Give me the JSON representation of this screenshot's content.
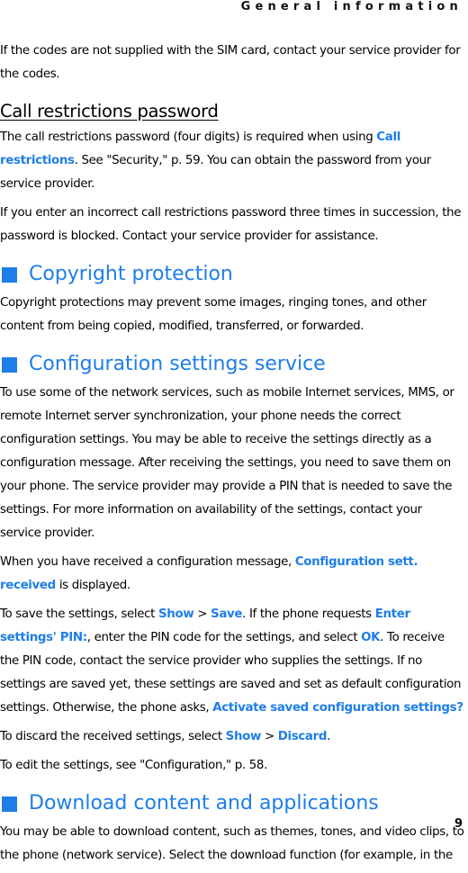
{
  "running_head": "General information",
  "page_number": "9",
  "accent_color": "#1e7ee8",
  "intro": {
    "text": "If the codes are not supplied with the SIM card, contact your service provider for the codes."
  },
  "call_restrictions": {
    "heading": "Call restrictions password",
    "p1": {
      "before": "The call restrictions password (four digits) is required when using ",
      "link": "Call restrictions",
      "after": ". See \"Security,\" p. 59. You can obtain the password from your service provider."
    },
    "p2": "If you enter an incorrect call restrictions password three times in succession, the password is blocked. Contact your service provider for assistance."
  },
  "copyright": {
    "heading": "Copyright protection",
    "p1": "Copyright protections may prevent some images, ringing tones, and other content from being copied, modified, transferred, or forwarded."
  },
  "configuration": {
    "heading": "Configuration settings service",
    "p1": "To use some of the network services, such as mobile Internet services, MMS, or remote Internet server synchronization, your phone needs the correct configuration settings. You may be able to receive the settings directly as a configuration message. After receiving the settings, you need to save them on your phone. The service provider may provide a PIN that is needed to save the settings. For more information on availability of the settings, contact your service provider.",
    "p2": {
      "before": "When you have received a configuration message, ",
      "link": "Configuration sett. received",
      "after": " is displayed."
    },
    "p3": {
      "t1": "To save the settings, select ",
      "l1": "Show",
      "t2": " > ",
      "l2": "Save",
      "t3": ". If the phone requests ",
      "l3": "Enter settings' PIN:",
      "t4": ", enter the PIN code for the settings, and select ",
      "l4": "OK",
      "t5": ". To receive the PIN code, contact the service provider who supplies the settings. If no settings are saved yet, these settings are saved and set as default configuration settings. Otherwise, the phone asks, ",
      "l5": "Activate saved configuration settings?"
    },
    "p4": {
      "t1": "To discard the received settings, select ",
      "l1": "Show",
      "t2": " > ",
      "l2": "Discard",
      "t3": "."
    },
    "p5": "To edit the settings, see \"Configuration,\" p. 58."
  },
  "download": {
    "heading": "Download content and applications",
    "p1": "You may be able to download content, such as themes, tones, and video clips, to the phone (network service). Select the download function (for example, in the"
  }
}
